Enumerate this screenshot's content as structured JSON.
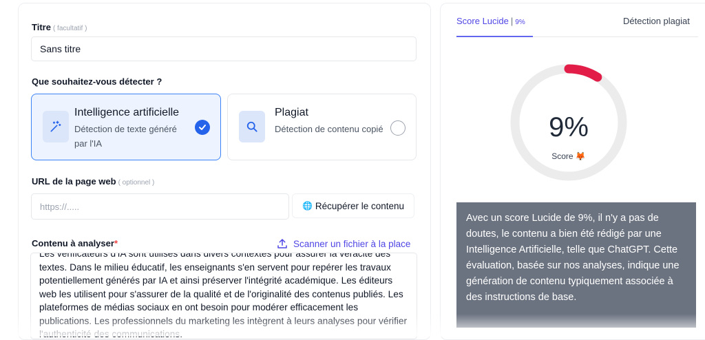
{
  "form": {
    "title_label": "Titre",
    "title_optional": "( facultatif )",
    "title_value": "Sans titre",
    "detect_label": "Que souhaitez-vous détecter ?",
    "options": [
      {
        "title": "Intelligence artificielle",
        "description": "Détection de texte généré par l'IA",
        "icon": "magic-wand-icon",
        "selected": true
      },
      {
        "title": "Plagiat",
        "description": "Détection de contenu copié",
        "icon": "search-icon",
        "selected": false
      }
    ],
    "url_label": "URL de la page web",
    "url_optional": "( optionnel )",
    "url_placeholder": "https://.....",
    "fetch_button": "Récupérer le contenu",
    "content_label": "Contenu à analyser",
    "content_required": "*",
    "scan_link": "Scanner un fichier à la place",
    "content_text": "Les vérificateurs d'IA sont utilisés dans divers contextes pour assurer la véracité des textes. Dans le milieu éducatif, les enseignants s'en servent pour repérer les travaux potentiellement générés par IA et ainsi préserver l'intégrité académique. Les éditeurs web les utilisent pour s'assurer de la qualité et de l'originalité des contenus publiés. Les plateformes de médias sociaux en ont besoin pour modérer efficacement les publications. Les professionnels du marketing les intègrent à leurs analyses pour vérifier l'authenticité des communications."
  },
  "results": {
    "tab_score": "Score Lucide",
    "tab_score_pct": "9%",
    "tab_plagiat": "Détection plagiat",
    "score_value": "9%",
    "score_fraction": 0.09,
    "score_label": "Score 🦊",
    "message": "Avec un score Lucide de 9%, il n'y a pas de doutes, le contenu a bien été rédigé par une Intelligence Artificielle, telle que ChatGPT. Cette évaluation, basée sur nos analyses, indique une génération de contenu typiquement associée à des instructions de base."
  },
  "colors": {
    "accent": "#4f46e5",
    "selected_border": "#3b82f6",
    "gauge_fill": "#e11d48",
    "gauge_track": "#ececec",
    "result_bg": "#6b7280"
  }
}
